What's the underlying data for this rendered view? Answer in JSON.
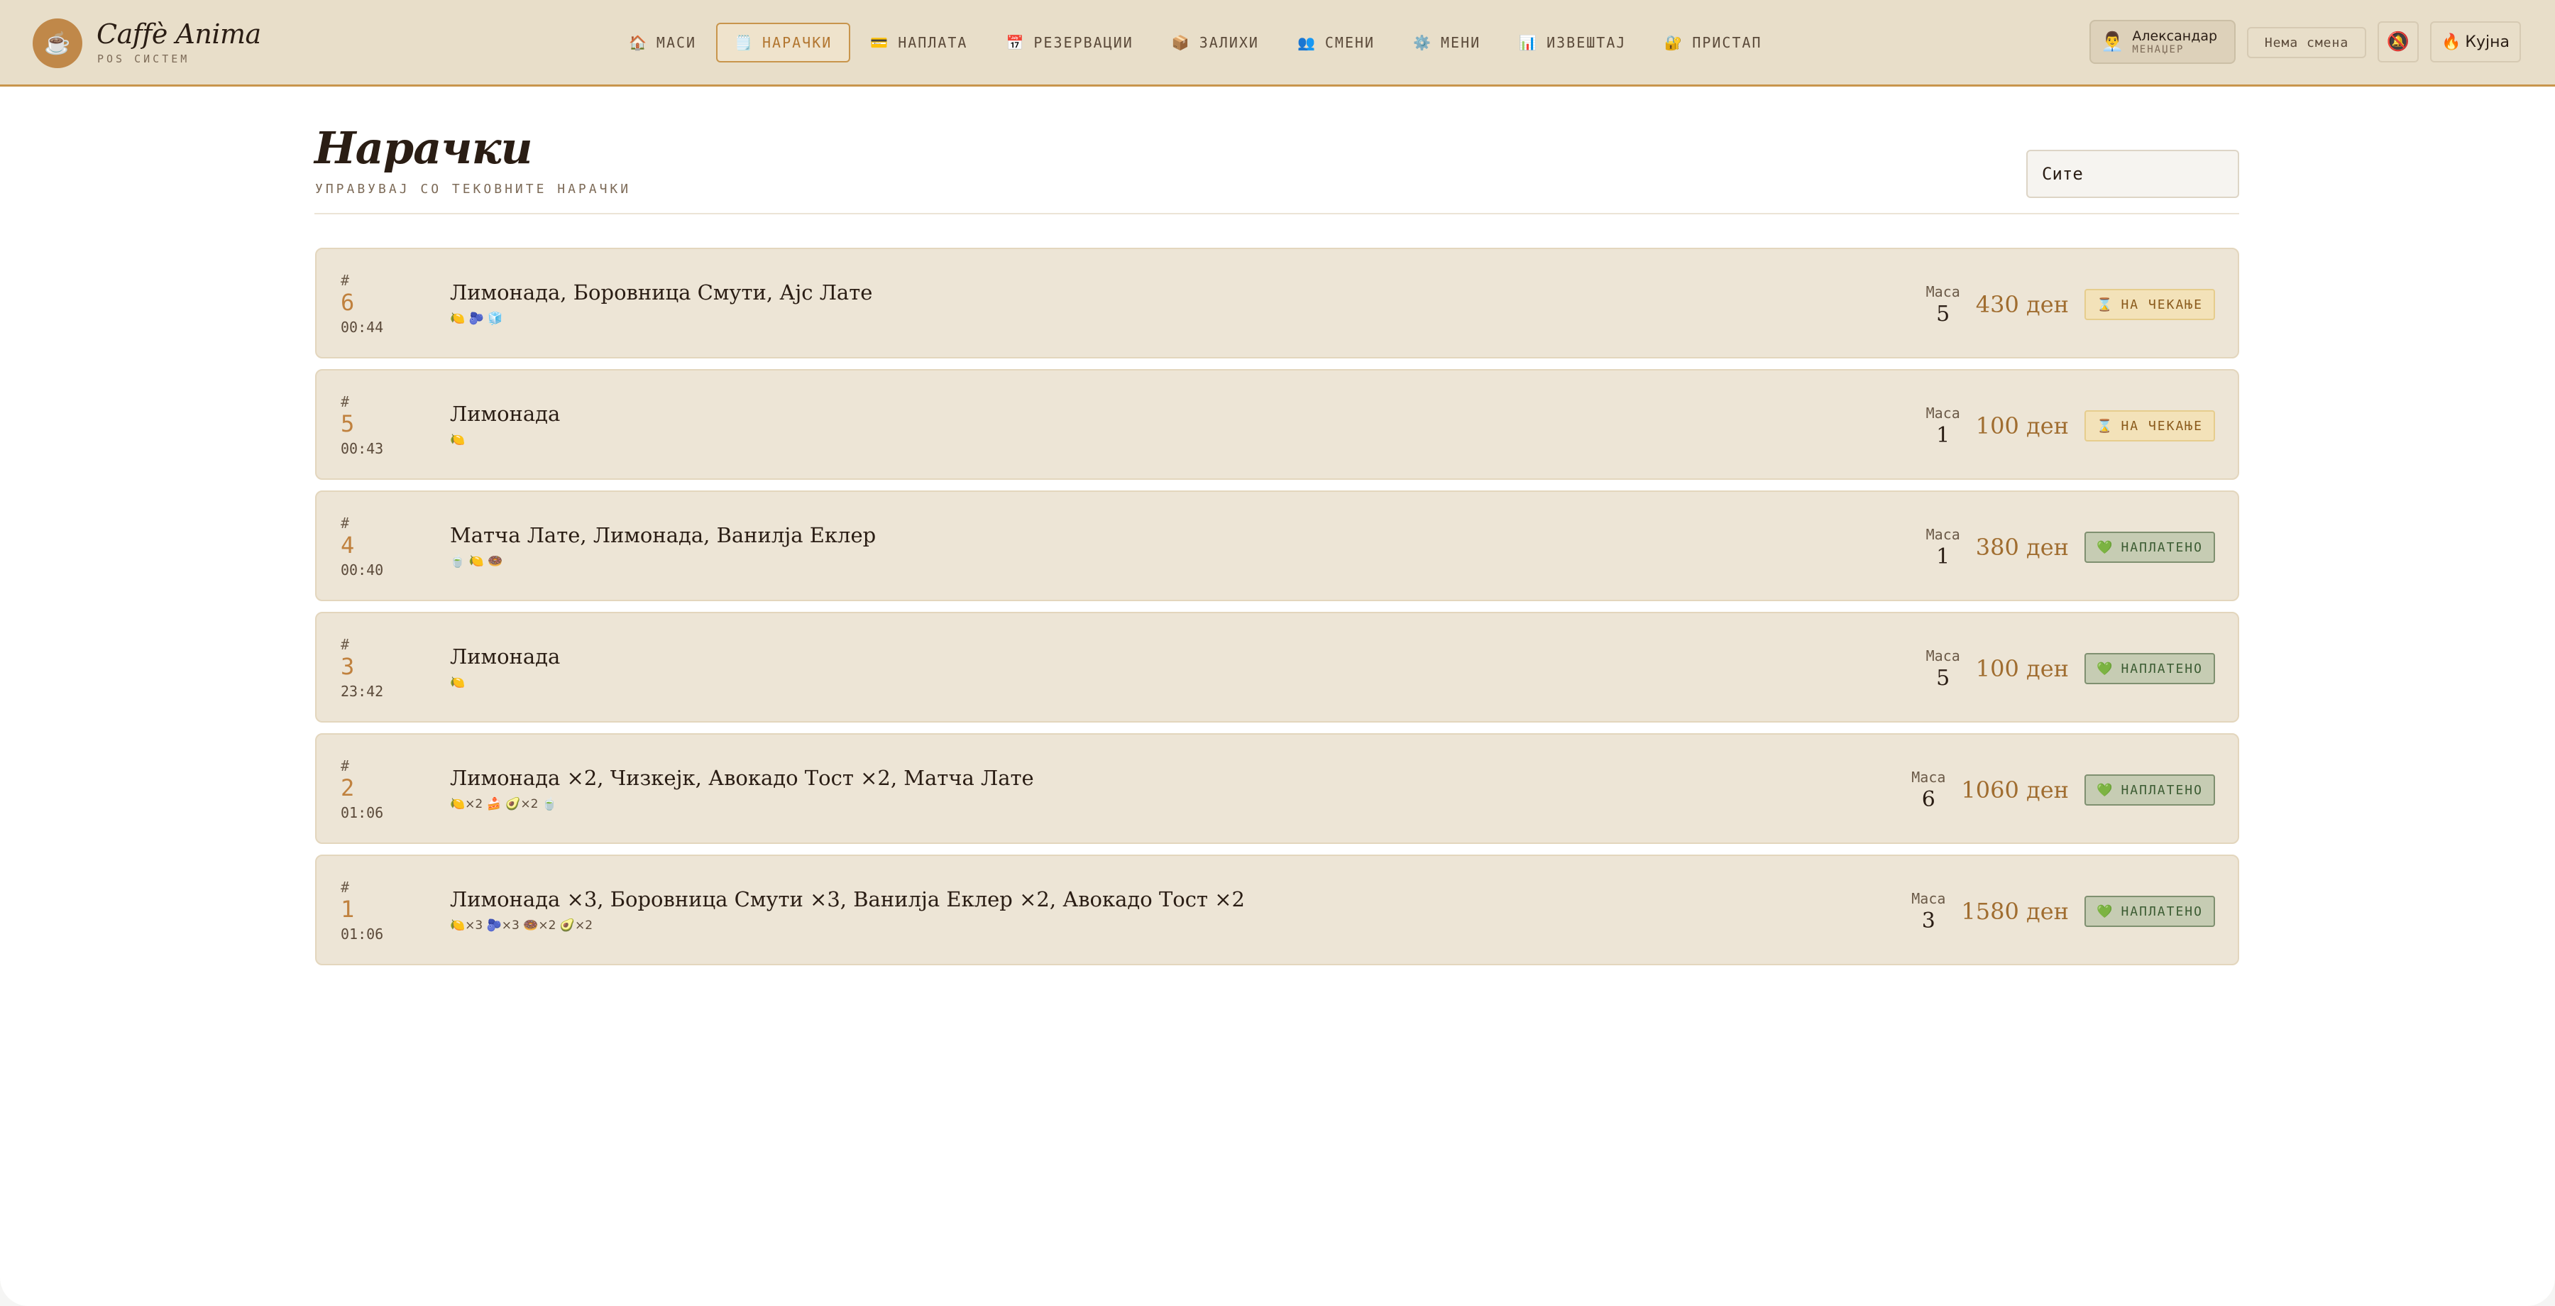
{
  "brand": {
    "logo_icon": "☕",
    "name": "Caffè Anima",
    "subtitle": "POS СИСТЕМ"
  },
  "nav": [
    {
      "icon": "🏠",
      "label": "МАСИ",
      "active": false
    },
    {
      "icon": "🗒️",
      "label": "НАРАЧКИ",
      "active": true
    },
    {
      "icon": "💳",
      "label": "НАПЛАТА",
      "active": false
    },
    {
      "icon": "📅",
      "label": "РЕЗЕРВАЦИИ",
      "active": false
    },
    {
      "icon": "📦",
      "label": "ЗАЛИХИ",
      "active": false
    },
    {
      "icon": "👥",
      "label": "СМЕНИ",
      "active": false
    },
    {
      "icon": "⚙️",
      "label": "МЕНИ",
      "active": false
    },
    {
      "icon": "📊",
      "label": "ИЗВЕШТАЈ",
      "active": false
    },
    {
      "icon": "🔐",
      "label": "ПРИСТАП",
      "active": false
    }
  ],
  "user": {
    "icon": "👨‍💼",
    "name": "Александар",
    "role": "МЕНАЏЕР"
  },
  "shift": {
    "label": "Нема смена"
  },
  "bell": {
    "icon": "🔕"
  },
  "kitchen": {
    "icon": "🔥",
    "label": "Кујна"
  },
  "page": {
    "title": "Нарачки",
    "subtitle": "УПРАВУВАЈ СО ТЕКОВНИТЕ НАРАЧКИ"
  },
  "filter": {
    "value": "Сите"
  },
  "orders": [
    {
      "hash": "#",
      "number": "6",
      "time": "00:44",
      "items": "Лимонада, Боровница Смути, Ајс Лате",
      "emoji": "🍋 🫐 🧊",
      "table_label": "Маса",
      "table": "5",
      "total": "430 ден",
      "status": "pending",
      "status_icon": "⌛",
      "status_label": "НА ЧЕКАЊЕ"
    },
    {
      "hash": "#",
      "number": "5",
      "time": "00:43",
      "items": "Лимонада",
      "emoji": "🍋",
      "table_label": "Маса",
      "table": "1",
      "total": "100 ден",
      "status": "pending",
      "status_icon": "⌛",
      "status_label": "НА ЧЕКАЊЕ"
    },
    {
      "hash": "#",
      "number": "4",
      "time": "00:40",
      "items": "Матча Лате, Лимонада, Ванилја Еклер",
      "emoji": "🍵 🍋 🍩",
      "table_label": "Маса",
      "table": "1",
      "total": "380 ден",
      "status": "paid",
      "status_icon": "💚",
      "status_label": "НАПЛАТЕНО"
    },
    {
      "hash": "#",
      "number": "3",
      "time": "23:42",
      "items": "Лимонада",
      "emoji": "🍋",
      "table_label": "Маса",
      "table": "5",
      "total": "100 ден",
      "status": "paid",
      "status_icon": "💚",
      "status_label": "НАПЛАТЕНО"
    },
    {
      "hash": "#",
      "number": "2",
      "time": "01:06",
      "items": "Лимонада ×2, Чизкејк, Авокадо Тост ×2, Матча Лате",
      "emoji": "🍋×2  🍰  🥑×2  🍵",
      "table_label": "Маса",
      "table": "6",
      "total": "1060 ден",
      "status": "paid",
      "status_icon": "💚",
      "status_label": "НАПЛАТЕНО"
    },
    {
      "hash": "#",
      "number": "1",
      "time": "01:06",
      "items": "Лимонада ×3, Боровница Смути ×3, Ванилја Еклер ×2, Авокадо Тост ×2",
      "emoji": "🍋×3  🫐×3  🍩×2  🥑×2",
      "table_label": "Маса",
      "table": "3",
      "total": "1580 ден",
      "status": "paid",
      "status_icon": "💚",
      "status_label": "НАПЛАТЕНО"
    }
  ]
}
